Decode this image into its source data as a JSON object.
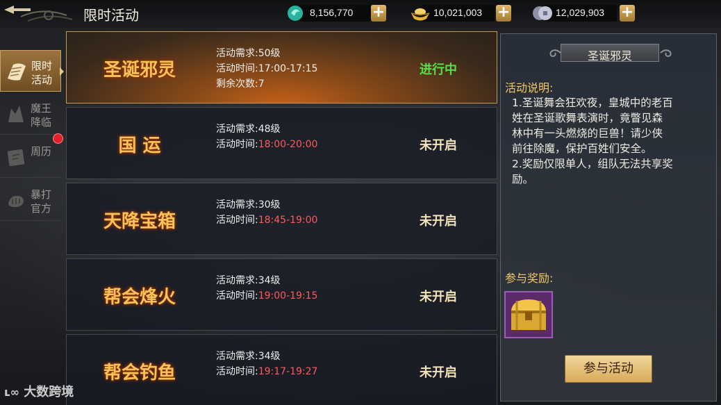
{
  "header": {
    "title": "限时活动",
    "currencies": [
      {
        "icon": "jade-icon",
        "value": "8,156,770"
      },
      {
        "icon": "gold-ingot-icon",
        "value": "10,021,003"
      },
      {
        "icon": "silver-coin-icon",
        "value": "12,029,903"
      }
    ],
    "add_label": "+"
  },
  "sidebar": {
    "items": [
      {
        "label": "限时活动",
        "icon": "scroll-icon",
        "active": true
      },
      {
        "label": "魔王降临",
        "icon": "demon-icon",
        "active": false
      },
      {
        "label": "周历",
        "icon": "calendar-icon",
        "active": false,
        "badge": true
      },
      {
        "label": "暴打官方",
        "icon": "fist-icon",
        "active": false
      }
    ]
  },
  "activities": [
    {
      "name": "圣诞邪灵",
      "req_label": "活动需求:",
      "req": "50级",
      "time_label": "活动时间:",
      "time": "17:00-17:15",
      "extra_label": "剩余次数:",
      "extra": "7",
      "status": "进行中",
      "active": true
    },
    {
      "name": "国 运",
      "req_label": "活动需求:",
      "req": "48级",
      "time_label": "活动时间:",
      "time": "18:00-20:00",
      "status": "未开启",
      "active": false
    },
    {
      "name": "天降宝箱",
      "req_label": "活动需求:",
      "req": "30级",
      "time_label": "活动时间:",
      "time": "18:45-19:00",
      "status": "未开启",
      "active": false
    },
    {
      "name": "帮会烽火",
      "req_label": "活动需求:",
      "req": "34级",
      "time_label": "活动时间:",
      "time": "19:00-19:15",
      "status": "未开启",
      "active": false
    },
    {
      "name": "帮会钓鱼",
      "req_label": "活动需求:",
      "req": "34级",
      "time_label": "活动时间:",
      "time": "19:17-19:27",
      "status": "未开启",
      "active": false
    }
  ],
  "detail": {
    "title": "圣诞邪灵",
    "desc_label": "活动说明:",
    "desc_lines": [
      "1.圣诞舞会狂欢夜，皇城中的老百",
      "姓在圣诞歌舞表演时，竟瞥见森",
      "林中有一头燃烧的巨兽！请少侠",
      "前往除魔，保护百姓们安全。",
      "2.奖励仅限单人，组队无法共享奖",
      "励。"
    ],
    "reward_label": "参与奖励:",
    "reward_icon": "treasure-chest-icon",
    "join_button": "参与活动"
  },
  "watermark": "大数跨境",
  "colors": {
    "accent_gold": "#f6c35a",
    "in_progress": "#53e04a",
    "time_red": "#ff5a5a",
    "badge_red": "#e0202a"
  }
}
